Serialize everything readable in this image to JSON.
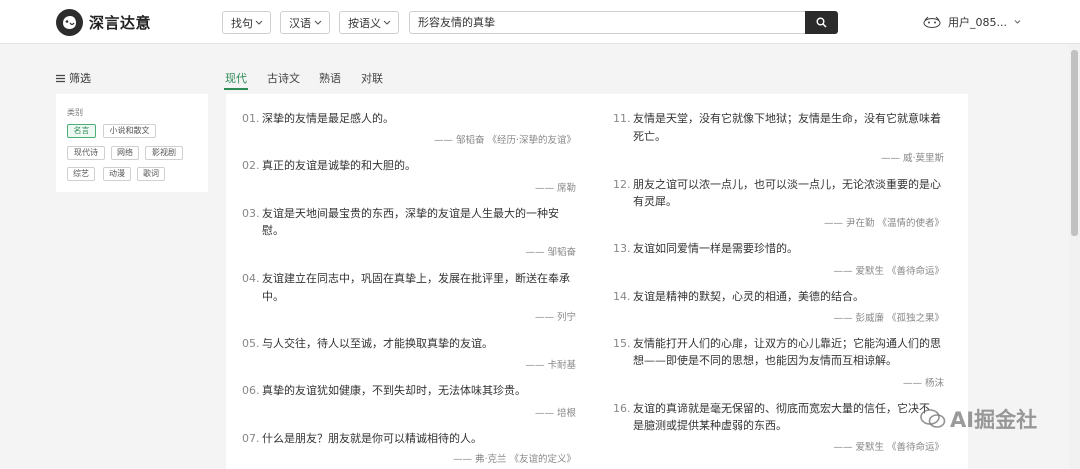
{
  "header": {
    "logo_text": "深言达意",
    "dropdowns": [
      "找句",
      "汉语",
      "按语义"
    ],
    "search_value": "形容友情的真挚",
    "user_name": "用户_085..."
  },
  "sidebar": {
    "title": "筛选",
    "category_label": "类别",
    "tags": [
      "名言",
      "小说和散文",
      "现代诗",
      "网络",
      "影视剧",
      "综艺",
      "动漫",
      "歌词"
    ],
    "active_tag": "名言"
  },
  "tabs": [
    "现代",
    "古诗文",
    "熟语",
    "对联"
  ],
  "active_tab": "现代",
  "quotes_left": [
    {
      "num": "01.",
      "lines": [
        "深挚的友情是最足感人的。"
      ],
      "source": "—— 邹韬奋 《经历·深挚的友谊》"
    },
    {
      "num": "02.",
      "lines": [
        "真正的友谊是诚挚的和大胆的。"
      ],
      "source": "—— 席勒"
    },
    {
      "num": "03.",
      "lines": [
        "友谊是天地间最宝贵的东西，深挚的友谊是人生最大的一种安",
        "慰。"
      ],
      "source": "—— 邹韬奋"
    },
    {
      "num": "04.",
      "lines": [
        "友谊建立在同志中，巩固在真挚上，发展在批评里，断送在奉承",
        "中。"
      ],
      "source": "—— 列宁"
    },
    {
      "num": "05.",
      "lines": [
        "与人交往，待人以至诚，才能换取真挚的友谊。"
      ],
      "source": "—— 卡耐基"
    },
    {
      "num": "06.",
      "lines": [
        "真挚的友谊犹如健康，不到失却时，无法体味其珍贵。"
      ],
      "source": "—— 培根"
    },
    {
      "num": "07.",
      "lines": [
        "什么是朋友？朋友就是你可以精诚相待的人。"
      ],
      "source": "—— 弗·克兰 《友谊的定义》"
    }
  ],
  "quotes_right": [
    {
      "num": "11.",
      "lines": [
        "友情是天堂，没有它就像下地狱；友情是生命，没有它就意味着",
        "死亡。"
      ],
      "source": "—— 威·莫里斯"
    },
    {
      "num": "12.",
      "lines": [
        "朋友之谊可以浓一点儿，也可以淡一点儿，无论浓淡重要的是心",
        "有灵犀。"
      ],
      "source": "—— 尹在勤 《温情的使者》"
    },
    {
      "num": "13.",
      "lines": [
        "友谊如同爱情一样是需要珍惜的。"
      ],
      "source": "—— 爱默生 《善待命运》"
    },
    {
      "num": "14.",
      "lines": [
        "友谊是精神的默契，心灵的相通，美德的结合。"
      ],
      "source": "—— 彭威廉 《孤独之果》"
    },
    {
      "num": "15.",
      "lines": [
        "友情能打开人们的心扉，让双方的心儿靠近；它能沟通人们的思",
        "想——即使是不同的思想，也能因为友情而互相谅解。"
      ],
      "source": "—— 杨沫"
    },
    {
      "num": "16.",
      "lines": [
        "友谊的真谛就是毫无保留的、彻底而宽宏大量的信任，它决不",
        "是臆测或提供某种虚弱的东西。"
      ],
      "source": "—— 爱默生 《善待命运》"
    }
  ],
  "watermark": "AI掘金社",
  "colors": {
    "accent": "#2e8b57",
    "dark": "#2b2b2b"
  }
}
